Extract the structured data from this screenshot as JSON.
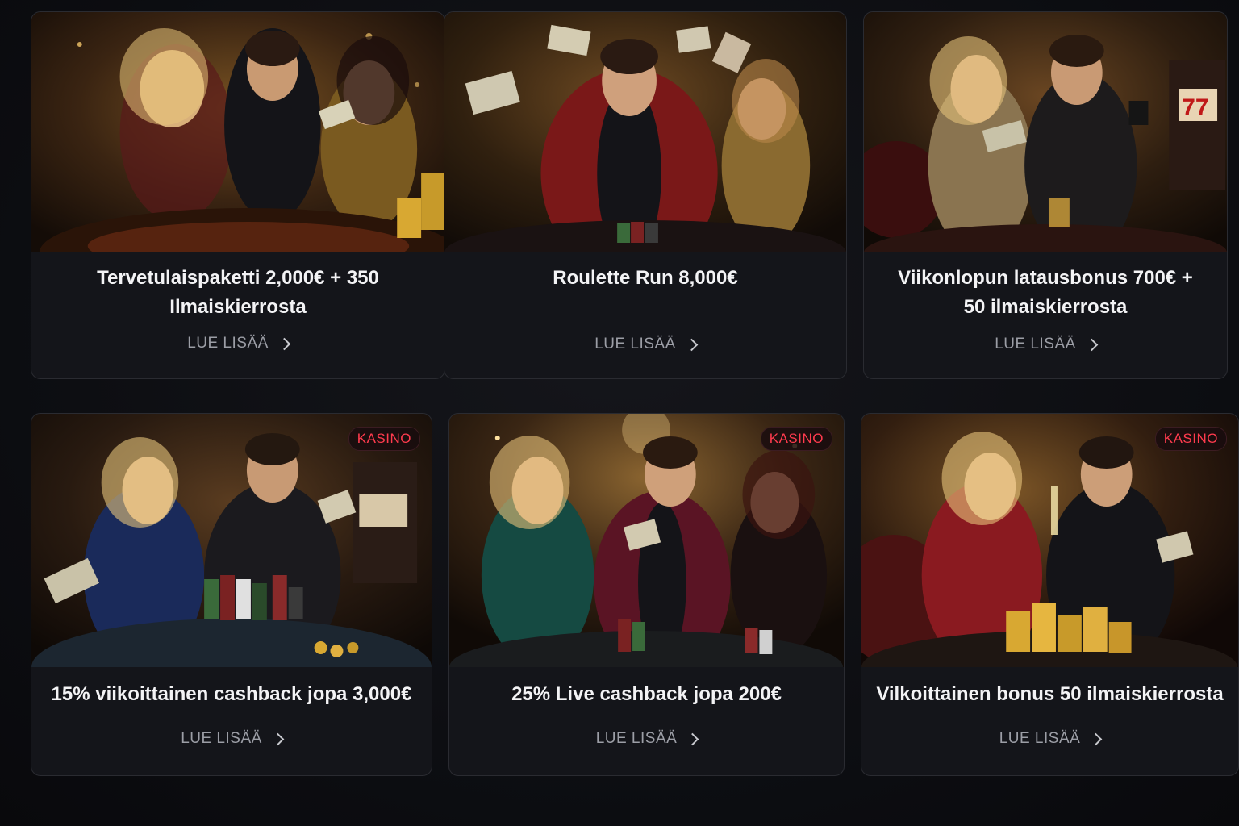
{
  "badge_color": "#ff3b4e",
  "background_color": "#0d0e12",
  "cards": [
    {
      "title": "Tervetulaispaketti 2,000€ + 350 Ilmaiskierrosta",
      "cta": "LUE LISÄÄ",
      "badge": "",
      "scene": "roulette-table-trio"
    },
    {
      "title": "Roulette Run 8,000€",
      "cta": "LUE LISÄÄ",
      "badge": "",
      "scene": "man-red-tuxedo-cards"
    },
    {
      "title": "Viikonlopun latausbonus 700€ + 50 ilmaiskierrosta",
      "cta": "LUE LISÄÄ",
      "badge": "",
      "scene": "couple-slot-machine"
    },
    {
      "title": "15% viikoittainen cashback jopa 3,000€",
      "cta": "LUE LISÄÄ",
      "badge": "KASINO",
      "scene": "couple-poker-chips"
    },
    {
      "title": "25% Live cashback jopa 200€",
      "cta": "LUE LISÄÄ",
      "badge": "KASINO",
      "scene": "trio-live-table"
    },
    {
      "title": "Vilkoittainen bonus 50 ilmaiskierrosta",
      "cta": "LUE LISÄÄ",
      "badge": "KASINO",
      "scene": "couple-champagne-gold"
    }
  ]
}
